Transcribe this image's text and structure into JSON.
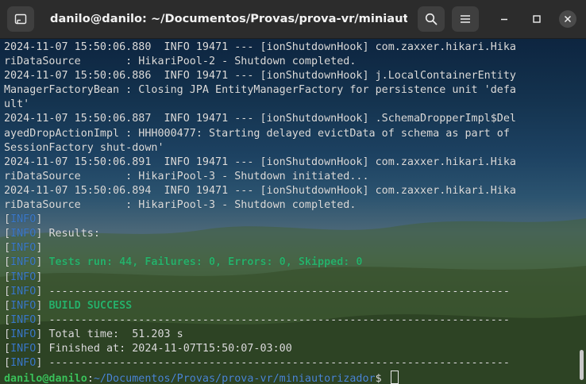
{
  "window": {
    "title": "danilo@danilo: ~/Documentos/Provas/prova-vr/miniautorizador"
  },
  "icons": {
    "new_tab": "new-tab-icon",
    "search": "search-icon",
    "menu": "hamburger-menu-icon",
    "minimize": "minimize-icon",
    "maximize": "maximize-icon",
    "close": "close-icon"
  },
  "colors": {
    "info_tag": "#3a78c8",
    "success": "#27b06a",
    "prompt_user": "#3bc15a",
    "prompt_path": "#4b86d6"
  },
  "terminal": {
    "log_lines": [
      "2024-11-07 15:50:06.880  INFO 19471 --- [ionShutdownHook] com.zaxxer.hikari.Hika",
      "riDataSource       : HikariPool-2 - Shutdown completed.",
      "2024-11-07 15:50:06.886  INFO 19471 --- [ionShutdownHook] j.LocalContainerEntity",
      "ManagerFactoryBean : Closing JPA EntityManagerFactory for persistence unit 'defa",
      "ult'",
      "2024-11-07 15:50:06.887  INFO 19471 --- [ionShutdownHook] .SchemaDropperImpl$Del",
      "ayedDropActionImpl : HHH000477: Starting delayed evictData of schema as part of",
      "SessionFactory shut-down'",
      "2024-11-07 15:50:06.891  INFO 19471 --- [ionShutdownHook] com.zaxxer.hikari.Hika",
      "riDataSource       : HikariPool-3 - Shutdown initiated...",
      "2024-11-07 15:50:06.894  INFO 19471 --- [ionShutdownHook] com.zaxxer.hikari.Hika",
      "riDataSource       : HikariPool-3 - Shutdown completed."
    ],
    "maven_tag": "INFO",
    "maven_lines": [
      {
        "text": "",
        "green": false
      },
      {
        "text": "Results:",
        "green": false
      },
      {
        "text": "",
        "green": false
      },
      {
        "text": "Tests run: 44, Failures: 0, Errors: 0, Skipped: 0",
        "green": true
      },
      {
        "text": "",
        "green": false
      },
      {
        "text": "------------------------------------------------------------------------",
        "green": false
      },
      {
        "text": "BUILD SUCCESS",
        "green": true
      },
      {
        "text": "------------------------------------------------------------------------",
        "green": false
      },
      {
        "text": "Total time:  51.203 s",
        "green": false
      },
      {
        "text": "Finished at: 2024-11-07T15:50:07-03:00",
        "green": false
      },
      {
        "text": "------------------------------------------------------------------------",
        "green": false
      }
    ],
    "prompt": {
      "user_host": "danilo@danilo",
      "separator": ":",
      "path": "~/Documentos/Provas/prova-vr/miniautorizador",
      "symbol": "$ "
    }
  }
}
